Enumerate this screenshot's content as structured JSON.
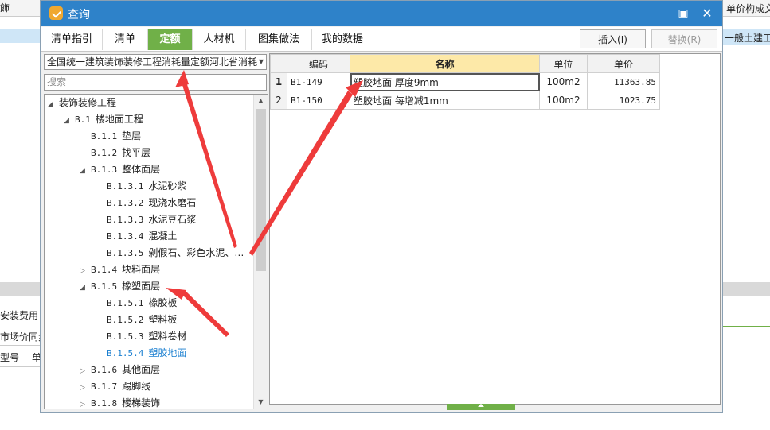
{
  "background": {
    "left_top_fragment": "飾",
    "right_top_header": "单价构成文",
    "right_top_cell": "一般土建工",
    "left_labels": [
      "安装费用",
      "市场价同步",
      "型号",
      "单"
    ]
  },
  "dialog": {
    "title": "查询",
    "tabs": [
      "清单指引",
      "清单",
      "定额",
      "人材机",
      "图集做法",
      "我的数据"
    ],
    "active_tab_index": 2,
    "insert_button": "插入(I)",
    "replace_button": "替换(R)",
    "minimize_icon": "minimize-icon",
    "close_icon": "close-icon"
  },
  "left": {
    "quota_library": "全国统一建筑装饰装修工程消耗量定额河北省消耗",
    "search_placeholder": "搜索",
    "tree": [
      {
        "code": "",
        "label": "装饰装修工程",
        "level": 0,
        "state": "expanded"
      },
      {
        "code": "B.1",
        "label": "楼地面工程",
        "level": 1,
        "state": "expanded"
      },
      {
        "code": "B.1.1",
        "label": "垫层",
        "level": 2,
        "state": "leaf"
      },
      {
        "code": "B.1.2",
        "label": "找平层",
        "level": 2,
        "state": "leaf"
      },
      {
        "code": "B.1.3",
        "label": "整体面层",
        "level": 2,
        "state": "expanded"
      },
      {
        "code": "B.1.3.1",
        "label": "水泥砂浆",
        "level": 3,
        "state": "leaf"
      },
      {
        "code": "B.1.3.2",
        "label": "现浇水磨石",
        "level": 3,
        "state": "leaf"
      },
      {
        "code": "B.1.3.3",
        "label": "水泥豆石浆",
        "level": 3,
        "state": "leaf"
      },
      {
        "code": "B.1.3.4",
        "label": "混凝土",
        "level": 3,
        "state": "leaf"
      },
      {
        "code": "B.1.3.5",
        "label": "剁假石、彩色水泥、…",
        "level": 3,
        "state": "leaf"
      },
      {
        "code": "B.1.4",
        "label": "块料面层",
        "level": 2,
        "state": "collapsed"
      },
      {
        "code": "B.1.5",
        "label": "橡塑面层",
        "level": 2,
        "state": "expanded"
      },
      {
        "code": "B.1.5.1",
        "label": "橡胶板",
        "level": 3,
        "state": "leaf"
      },
      {
        "code": "B.1.5.2",
        "label": "塑料板",
        "level": 3,
        "state": "leaf"
      },
      {
        "code": "B.1.5.3",
        "label": "塑料卷材",
        "level": 3,
        "state": "leaf"
      },
      {
        "code": "B.1.5.4",
        "label": "塑胶地面",
        "level": 3,
        "state": "selected"
      },
      {
        "code": "B.1.6",
        "label": "其他面层",
        "level": 2,
        "state": "collapsed"
      },
      {
        "code": "B.1.7",
        "label": "踢脚线",
        "level": 2,
        "state": "collapsed"
      },
      {
        "code": "B.1.8",
        "label": "楼梯装饰",
        "level": 2,
        "state": "collapsed"
      }
    ]
  },
  "grid": {
    "headers": [
      "",
      "编码",
      "名称",
      "单位",
      "单价"
    ],
    "rows": [
      {
        "idx": "1",
        "code": "B1-149",
        "name": "塑胶地面 厚度9mm",
        "unit": "100m2",
        "price": "11363.85"
      },
      {
        "idx": "2",
        "code": "B1-150",
        "name": "塑胶地面 每增减1mm",
        "unit": "100m2",
        "price": "1023.75"
      }
    ]
  },
  "colors": {
    "titlebar": "#2e82c9",
    "active_tab": "#70b048",
    "selected_tree": "#1a7fd0",
    "annotation_arrow": "#ee3b3b"
  }
}
